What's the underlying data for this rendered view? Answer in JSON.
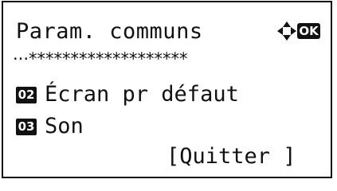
{
  "header": {
    "title": "Param. communs",
    "ok_label": "OK",
    "separator": "···*******************"
  },
  "menu": {
    "items": [
      {
        "number": "02",
        "label": "Écran pr défaut"
      },
      {
        "number": "03",
        "label": "Son"
      }
    ]
  },
  "footer": {
    "quit_label": "[Quitter ]"
  },
  "icons": {
    "navigation": "four-way-arrow-icon",
    "ok": "ok-key-icon"
  },
  "colors": {
    "foreground": "#111111",
    "background": "#ffffff"
  }
}
